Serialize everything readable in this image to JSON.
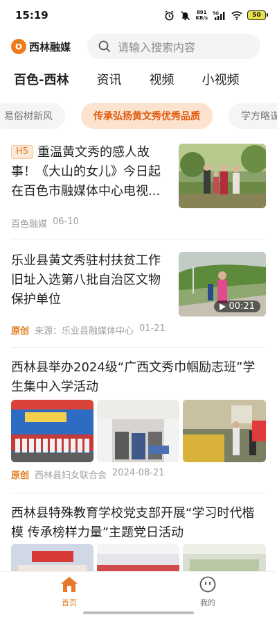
{
  "status_bar": {
    "time": "15:19",
    "net_speed_value": "891",
    "net_speed_unit": "KB/s",
    "network": "5G",
    "battery": "50",
    "icons": [
      "alarm-icon",
      "mute-icon",
      "signal-icon",
      "wifi-icon",
      "battery-icon"
    ]
  },
  "header": {
    "logo_text": "西林融媒",
    "search_placeholder": "请输入搜索内容"
  },
  "nav": {
    "items": [
      {
        "label": "百色-西林",
        "active": true
      },
      {
        "label": "资讯",
        "active": false
      },
      {
        "label": "视频",
        "active": false
      },
      {
        "label": "小视频",
        "active": false
      }
    ]
  },
  "chips": [
    {
      "label": "易俗树新风",
      "active": false
    },
    {
      "label": "传承弘扬黄文秀优秀品质",
      "active": true
    },
    {
      "label": "学方略谋",
      "active": false
    }
  ],
  "articles": [
    {
      "tag": "H5",
      "title": "重温黄文秀的感人故事！《大山的女儿》今日起在百色市融媒体中心电视...",
      "source": "百色融媒",
      "date": "06-10"
    },
    {
      "title": "乐业县黄文秀驻村扶贫工作旧址入选第八批自治区文物保护单位",
      "original": "原创",
      "source": "来源：乐业县融媒体中心",
      "date": "01-21",
      "duration": "00:21"
    },
    {
      "title": "西林县举办2024级“广西文秀巾帼励志班”学生集中入学活动",
      "original": "原创",
      "source": "西林县妇女联合会",
      "date": "2024-08-21"
    },
    {
      "title": "西林县特殊教育学校党支部开展“学习时代楷模 传承榜样力量”主题党日活动"
    }
  ],
  "tabbar": {
    "items": [
      {
        "label": "首页",
        "icon": "home-icon",
        "active": true
      },
      {
        "label": "我的",
        "icon": "profile-icon",
        "active": false
      }
    ]
  },
  "colors": {
    "accent": "#e07a1a",
    "chip_active_bg": "#fbe3cf",
    "search_bg": "#f3f4f6"
  }
}
